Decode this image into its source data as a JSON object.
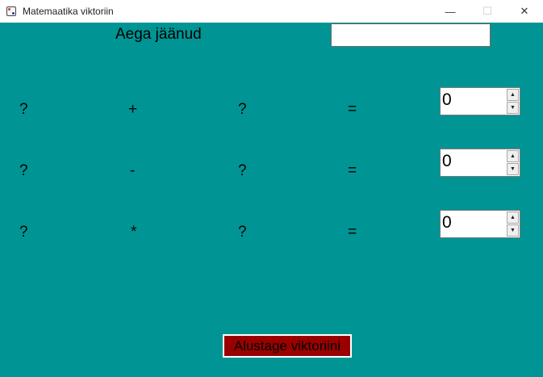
{
  "window": {
    "title": "Matemaatika viktoriin",
    "controls": {
      "minimize": "—",
      "maximize": "☐",
      "close": "✕"
    }
  },
  "timer": {
    "label": "Aega jäänud",
    "value": ""
  },
  "rows": [
    {
      "left": "?",
      "operator": "+",
      "right": "?",
      "equals": "=",
      "answer": "0"
    },
    {
      "left": "?",
      "operator": "-",
      "right": "?",
      "equals": "=",
      "answer": "0"
    },
    {
      "left": "?",
      "operator": "*",
      "right": "?",
      "equals": "=",
      "answer": "0"
    }
  ],
  "spinner": {
    "up": "▲",
    "down": "▼"
  },
  "start_button": {
    "label": "Alustage viktoriini"
  },
  "colors": {
    "background": "#009494",
    "button": "#9b0000"
  }
}
